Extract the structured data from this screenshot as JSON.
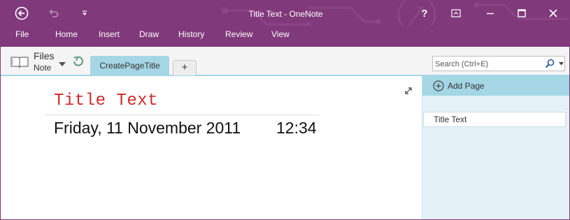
{
  "window": {
    "title": "Title Text - OneNote"
  },
  "titlebar": {
    "back_icon": "back-arrow-icon",
    "undo_icon": "undo-icon",
    "qat_icon": "customize-quick-access-icon",
    "help_label": "?",
    "ribbon_options_icon": "ribbon-display-options-icon",
    "minimize_icon": "minimize-icon",
    "maximize_icon": "maximize-icon",
    "close_icon": "close-icon"
  },
  "ribbon": {
    "tabs": [
      "File",
      "Home",
      "Insert",
      "Draw",
      "History",
      "Review",
      "View"
    ]
  },
  "notebook_bar": {
    "notebook_name": "Files",
    "section_label": "Note",
    "sections": [
      {
        "label": "CreatePageTitle",
        "active": true
      }
    ],
    "add_section_label": "+"
  },
  "search": {
    "placeholder": "Search (Ctrl+E)"
  },
  "page": {
    "title": "Title Text",
    "date": "Friday, 11 November 2011",
    "time": "12:34"
  },
  "page_list": {
    "add_page_label": "Add Page",
    "pages": [
      "Title Text"
    ]
  },
  "colors": {
    "accent": "#80397b",
    "section_tab": "#a5d6e5",
    "page_pane": "#e4f2f7",
    "title_text": "#cc2b2b"
  }
}
